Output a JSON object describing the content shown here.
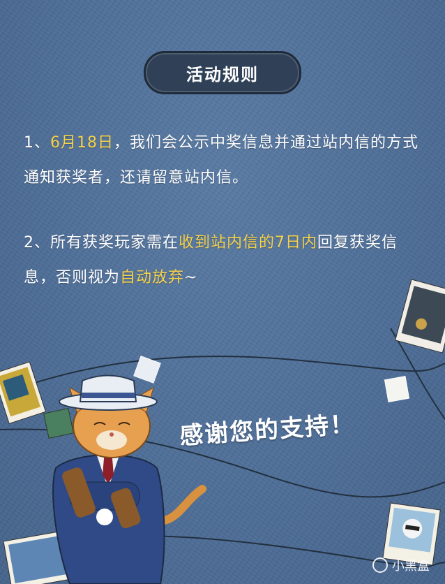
{
  "title": "活动规则",
  "rules": {
    "r1_prefix": "1、",
    "r1_date": "6月18日",
    "r1_rest": "，我们会公示中奖信息并通过站内信的方式通知获奖者，还请留意站内信。",
    "r2_prefix": "2、所有获奖玩家需在",
    "r2_hl1": "收到站内信的7日内",
    "r2_mid": "回复获奖信息，否则视为",
    "r2_hl2": "自动放弃",
    "r2_end": "~"
  },
  "thanks": "感谢您的支持！",
  "watermark": "小黑盒",
  "colors": {
    "background": "#4f6f98",
    "highlight": "#f6d24a",
    "pill": "#2f4057"
  }
}
